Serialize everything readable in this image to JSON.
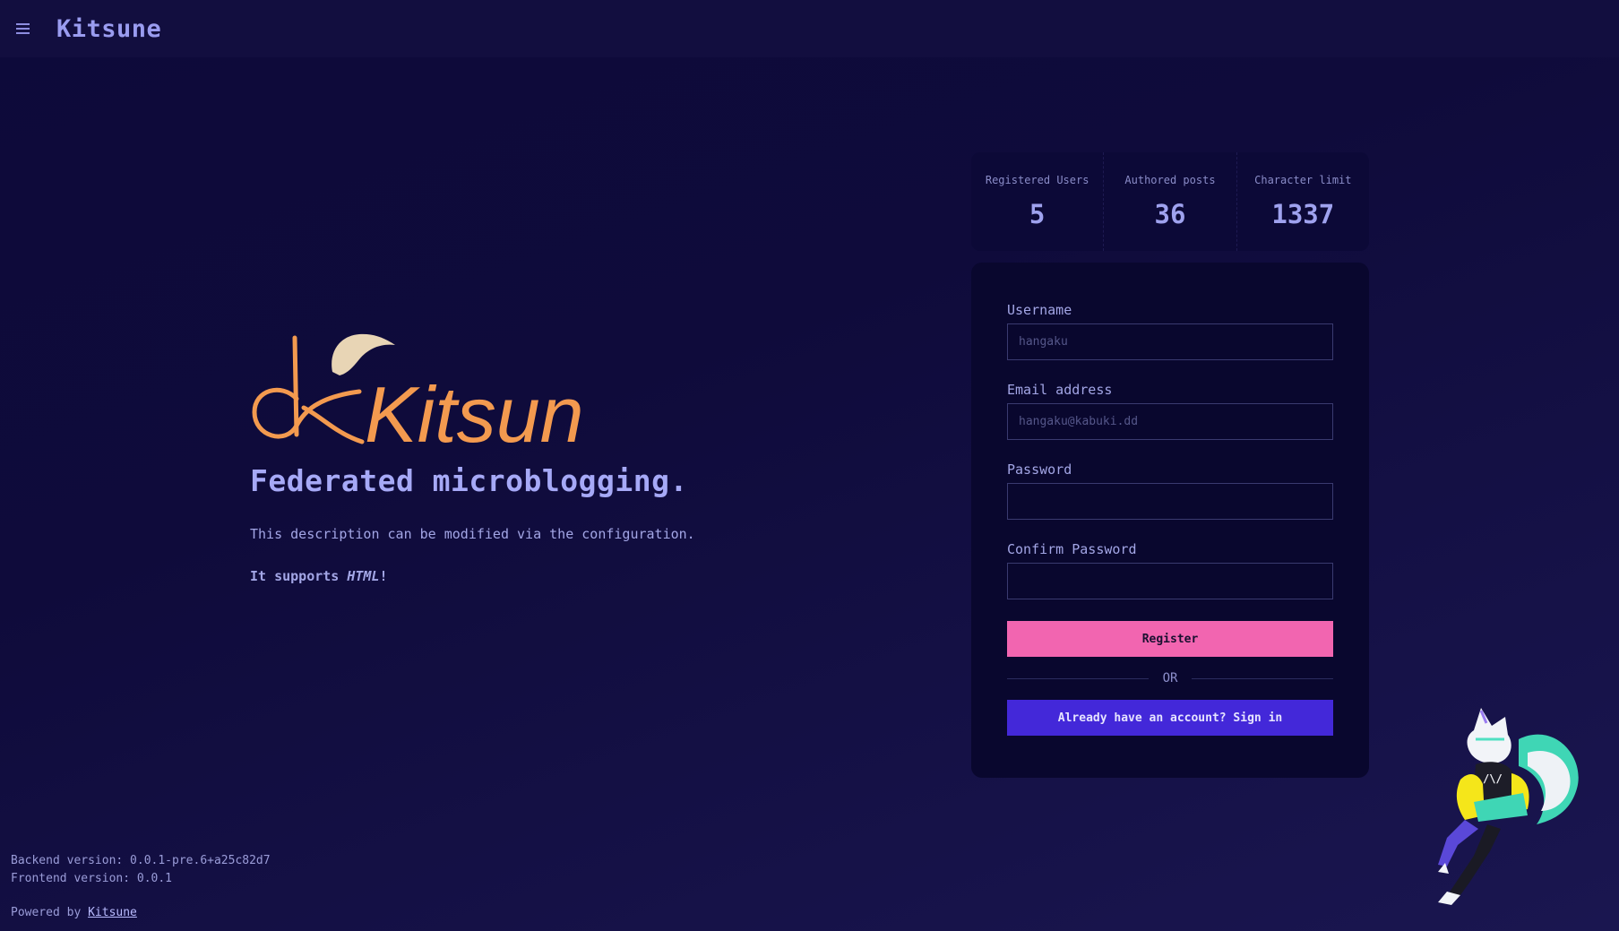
{
  "app": {
    "title": "Kitsune"
  },
  "hero": {
    "logo_text": "Kitsune",
    "tagline": "Federated microblogging.",
    "description": "This description can be modified via the configuration.",
    "support_prefix": "It supports ",
    "support_em": "HTML",
    "support_suffix": "!"
  },
  "stats": [
    {
      "label": "Registered Users",
      "value": "5"
    },
    {
      "label": "Authored posts",
      "value": "36"
    },
    {
      "label": "Character limit",
      "value": "1337"
    }
  ],
  "form": {
    "username": {
      "label": "Username",
      "placeholder": "hangaku",
      "value": ""
    },
    "email": {
      "label": "Email address",
      "placeholder": "hangaku@kabuki.dd",
      "value": ""
    },
    "password": {
      "label": "Password",
      "placeholder": "",
      "value": ""
    },
    "confirm_password": {
      "label": "Confirm Password",
      "placeholder": "",
      "value": ""
    },
    "register_label": "Register",
    "or_label": "OR",
    "signin_label": "Already have an account? Sign in"
  },
  "footer": {
    "backend_version": "Backend version: 0.0.1-pre.6+a25c82d7",
    "frontend_version": "Frontend version: 0.0.1",
    "powered_prefix": "Powered by ",
    "powered_link": "Kitsune"
  },
  "colors": {
    "register_button": "#f265b0",
    "signin_button": "#4328d9",
    "logo_orange": "#f39a4f",
    "logo_ear": "#e8d5b5"
  },
  "icons": {
    "menu": "hamburger-menu-icon"
  }
}
